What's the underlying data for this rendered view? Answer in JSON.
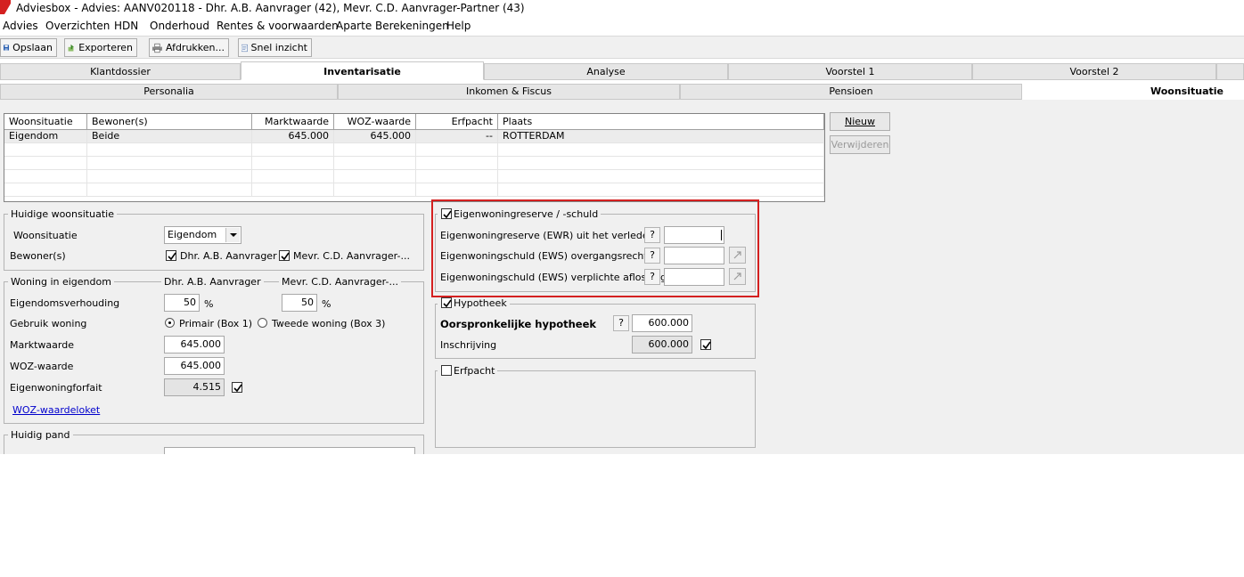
{
  "window": {
    "title": "Adviesbox - Advies: AANV020118 - Dhr. A.B. Aanvrager (42), Mevr. C.D. Aanvrager-Partner (43)"
  },
  "menu": [
    "Advies",
    "Overzichten",
    "HDN",
    "Onderhoud",
    "Rentes & voorwaarden",
    "Aparte Berekeningen",
    "Help"
  ],
  "toolbar": {
    "save": "Opslaan",
    "export": "Exporteren",
    "print": "Afdrukken...",
    "quick": "Snel inzicht"
  },
  "tabs_main": [
    "Klantdossier",
    "Inventarisatie",
    "Analyse",
    "Voorstel 1",
    "Voorstel 2"
  ],
  "tabs_sub": [
    "Personalia",
    "Inkomen & Fiscus",
    "Pensioen",
    "Woonsituatie"
  ],
  "grid": {
    "headers": [
      "Woonsituatie",
      "Bewoner(s)",
      "Marktwaarde",
      "WOZ-waarde",
      "Erfpacht",
      "Plaats"
    ],
    "rows": [
      [
        "Eigendom",
        "Beide",
        "645.000",
        "645.000",
        "--",
        "ROTTERDAM"
      ]
    ]
  },
  "buttons": {
    "new": "Nieuw",
    "delete": "Verwijderen"
  },
  "huidige": {
    "legend": "Huidige woonsituatie",
    "woonsituatie_label": "Woonsituatie",
    "woonsituatie_value": "Eigendom",
    "bewoners_label": "Bewoner(s)",
    "bewoner1": "Dhr. A.B. Aanvrager",
    "bewoner2": "Mevr. C.D. Aanvrager-..."
  },
  "woning": {
    "legend": "Woning in eigendom",
    "col1": "Dhr. A.B. Aanvrager",
    "col2": "Mevr. C.D. Aanvrager-...",
    "eigendom_label": "Eigendomsverhouding",
    "eigendom1": "50",
    "eigendom2": "50",
    "pct": "%",
    "gebruik_label": "Gebruik woning",
    "primair": "Primair  (Box 1)",
    "tweede": "Tweede woning  (Box 3)",
    "markt_label": "Marktwaarde",
    "markt_value": "645.000",
    "woz_label": "WOZ-waarde",
    "woz_value": "645.000",
    "forfait_label": "Eigenwoningforfait",
    "forfait_value": "4.515",
    "link": "WOZ-waardeloket"
  },
  "pand": {
    "legend": "Huidig pand"
  },
  "ewr": {
    "legend": "Eigenwoningreserve / -schuld",
    "row1": "Eigenwoningreserve (EWR) uit het verleden",
    "row2": "Eigenwoningschuld (EWS) overgangsrecht",
    "row3": "Eigenwoningschuld (EWS) verplichte aflossing",
    "q": "?"
  },
  "hypotheek": {
    "legend": "Hypotheek",
    "orig_label": "Oorspronkelijke hypotheek",
    "orig_value": "600.000",
    "inschr_label": "Inschrijving",
    "inschr_value": "600.000"
  },
  "erfpacht": {
    "legend": "Erfpacht"
  }
}
